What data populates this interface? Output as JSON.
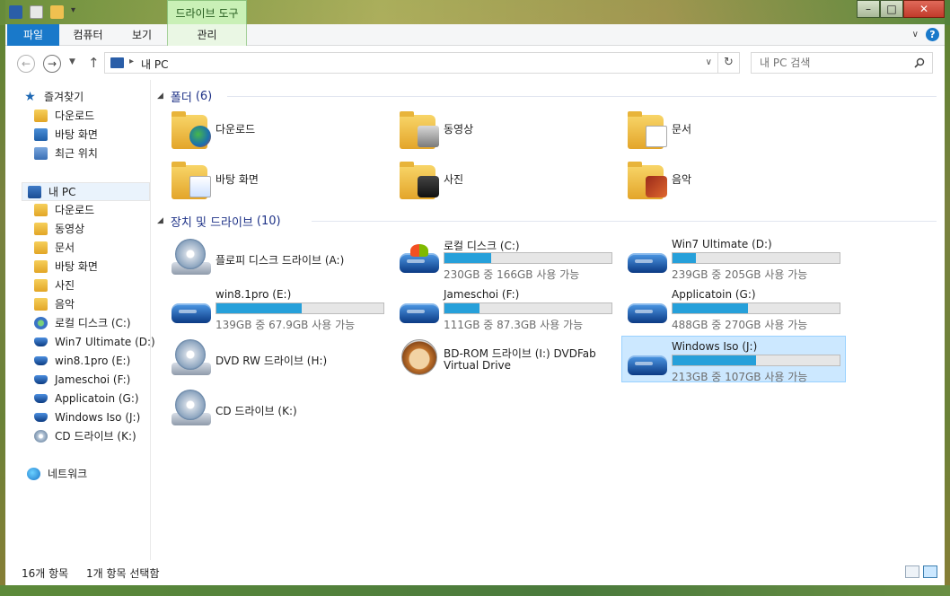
{
  "titlebar": {
    "context_tab": "드라이브 도구",
    "buttons": {
      "minimize": "–",
      "maximize": "□",
      "close": "✕"
    }
  },
  "ribbon": {
    "tabs": [
      "파일",
      "컴퓨터",
      "보기",
      "관리"
    ],
    "help": "?",
    "collapse": "∨"
  },
  "address": {
    "back": "←",
    "forward": "→",
    "up": "↑",
    "sep": "▸",
    "path": "내 PC",
    "dropdown": "∨",
    "refresh": "↻",
    "search_placeholder": "내 PC 검색"
  },
  "nav": {
    "favorites": {
      "label": "즐겨찾기",
      "items": [
        "다운로드",
        "바탕 화면",
        "최근 위치"
      ]
    },
    "pc": {
      "label": "내 PC",
      "items": [
        "다운로드",
        "동영상",
        "문서",
        "바탕 화면",
        "사진",
        "음악",
        "로컬 디스크 (C:)",
        "Win7 Ultimate (D:)",
        "win8.1pro (E:)",
        "Jameschoi (F:)",
        "Applicatoin (G:)",
        "Windows Iso (J:)",
        "CD 드라이브 (K:)"
      ]
    },
    "network": "네트워크"
  },
  "folders": {
    "header": "폴더",
    "count": "(6)",
    "items": [
      {
        "name": "다운로드",
        "icon": "download-folder-icon"
      },
      {
        "name": "동영상",
        "icon": "videos-folder-icon"
      },
      {
        "name": "문서",
        "icon": "documents-folder-icon"
      },
      {
        "name": "바탕 화면",
        "icon": "desktop-folder-icon"
      },
      {
        "name": "사진",
        "icon": "pictures-folder-icon"
      },
      {
        "name": "음악",
        "icon": "music-folder-icon"
      }
    ]
  },
  "drives": {
    "header": "장치 및 드라이브",
    "count": "(10)",
    "items": [
      {
        "name": "플로피 디스크 드라이브 (A:)",
        "icon": "floppy-drive-icon"
      },
      {
        "name": "로컬 디스크 (C:)",
        "free": "230GB 중 166GB 사용 가능",
        "used_fraction": 0.28,
        "icon": "windows-drive-icon"
      },
      {
        "name": "Win7 Ultimate (D:)",
        "free": "239GB 중 205GB 사용 가능",
        "used_fraction": 0.14,
        "icon": "hdd-icon"
      },
      {
        "name": "win8.1pro (E:)",
        "free": "139GB 중 67.9GB 사용 가능",
        "used_fraction": 0.51,
        "icon": "hdd-icon"
      },
      {
        "name": "Jameschoi (F:)",
        "free": "111GB 중 87.3GB 사용 가능",
        "used_fraction": 0.21,
        "icon": "hdd-icon"
      },
      {
        "name": "Applicatoin (G:)",
        "free": "488GB 중 270GB 사용 가능",
        "used_fraction": 0.45,
        "icon": "hdd-icon"
      },
      {
        "name": "DVD RW 드라이브 (H:)",
        "icon": "dvd-drive-icon"
      },
      {
        "name": "BD-ROM 드라이브 (I:) DVDFab",
        "line2": "Virtual Drive",
        "icon": "dvdfab-icon"
      },
      {
        "name": "Windows Iso (J:)",
        "free": "213GB 중 107GB 사용 가능",
        "used_fraction": 0.5,
        "icon": "hdd-icon"
      },
      {
        "name": "CD 드라이브 (K:)",
        "icon": "cd-drive-icon"
      }
    ]
  },
  "status": {
    "items": "16개 항목",
    "selected": "1개 항목 선택함"
  },
  "colors": {
    "accent": "#1979ca",
    "bar_fill": "#26a0da",
    "selection": "#cce8ff",
    "group_header": "#1e3287"
  }
}
